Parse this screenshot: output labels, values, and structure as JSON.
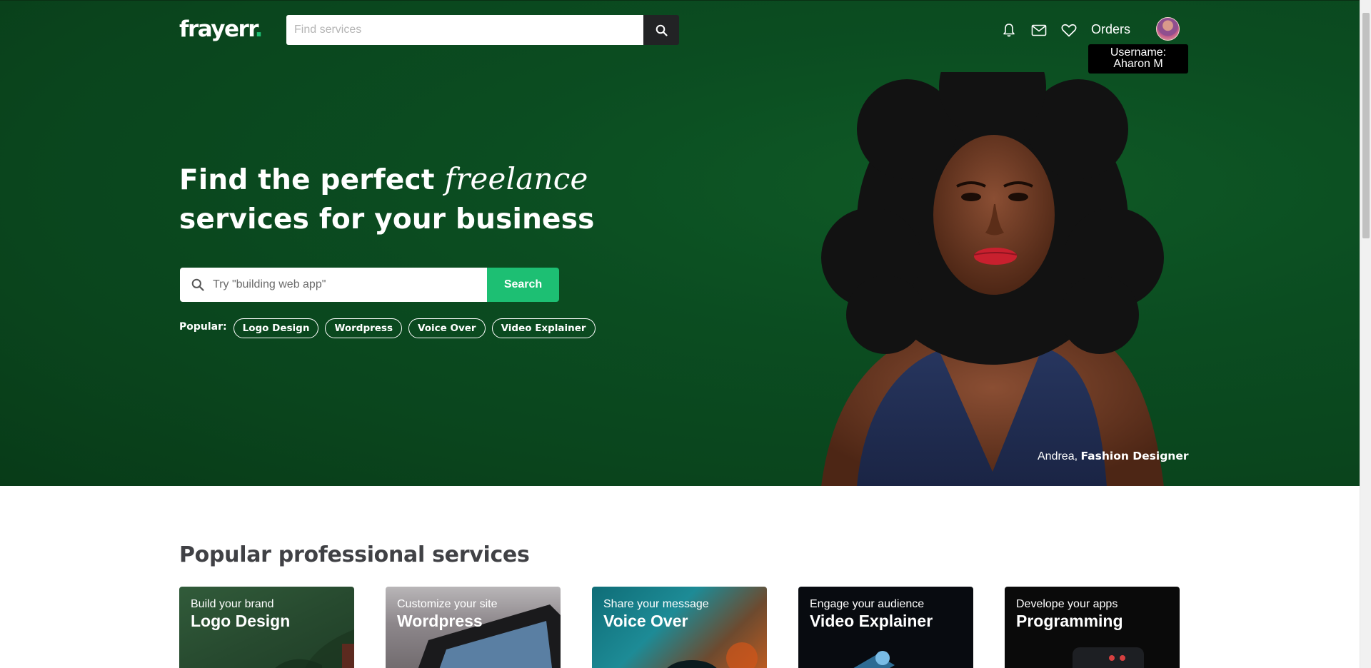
{
  "brand": {
    "logo_text": "frayerr",
    "logo_dot": ".",
    "accent": "#1dbf73",
    "hero_bg": "#0b4d21"
  },
  "nav": {
    "search_placeholder": "Find services",
    "orders_label": "Orders",
    "icons": [
      "bell-icon",
      "mail-icon",
      "heart-icon"
    ],
    "username_label": "Username:",
    "username_value": "Aharon M"
  },
  "hero": {
    "title_part1": "Find the perfect ",
    "title_italic": "freelance",
    "title_part2": "services for your business",
    "search_placeholder": "Try \"building web app\"",
    "search_button": "Search",
    "popular_label": "Popular:",
    "popular_tags": [
      "Logo Design",
      "Wordpress",
      "Voice Over",
      "Video Explainer"
    ],
    "caption_name": "Andrea, ",
    "caption_role": "Fashion Designer"
  },
  "popular_services": {
    "title": "Popular professional services",
    "cards": [
      {
        "subtitle": "Build your brand",
        "title": "Logo Design"
      },
      {
        "subtitle": "Customize your site",
        "title": "Wordpress"
      },
      {
        "subtitle": "Share your message",
        "title": "Voice Over"
      },
      {
        "subtitle": "Engage your audience",
        "title": "Video Explainer"
      },
      {
        "subtitle": "Develope your apps",
        "title": "Programming"
      }
    ]
  }
}
